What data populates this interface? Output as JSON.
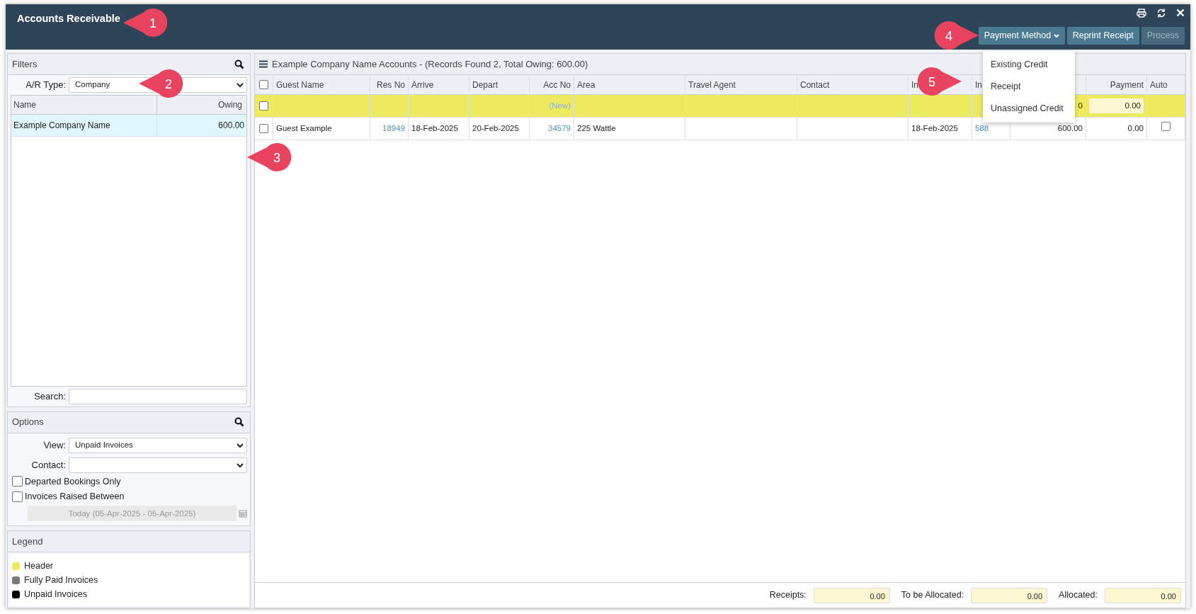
{
  "window": {
    "title": "Accounts Receivable"
  },
  "toolbar": {
    "buttons": [
      {
        "label": "Payment Method",
        "kind": "dropdown",
        "expanded": true,
        "disabled": false
      },
      {
        "label": "Reprint Receipt",
        "kind": "plain",
        "disabled": false
      },
      {
        "label": "Process",
        "kind": "plain",
        "disabled": true
      }
    ],
    "menu": [
      "Existing Credit",
      "Receipt",
      "Unassigned Credit"
    ]
  },
  "filters": {
    "title": "Filters",
    "ar_type_label": "A/R Type:",
    "ar_type_value": "Company",
    "columns": [
      "Name",
      "Owing"
    ],
    "rows": [
      {
        "name": "Example Company Name",
        "owing": "600.00",
        "selected": true
      }
    ],
    "search_label": "Search:"
  },
  "options": {
    "title": "Options",
    "view_label": "View:",
    "view_value": "Unpaid Invoices",
    "contact_label": "Contact:",
    "checkboxes": [
      {
        "label": "Departed Bookings Only",
        "checked": false
      },
      {
        "label": "Invoices Raised Between",
        "checked": false
      }
    ],
    "date_range": {
      "value": "Today (05-Apr-2025 - 05-Apr-2025)",
      "disabled": true
    }
  },
  "legend": {
    "title": "Legend",
    "items": [
      {
        "label": "Header",
        "color": "#eeea5e"
      },
      {
        "label": "Fully Paid Invoices",
        "color": "#7a7a7a"
      },
      {
        "label": "Unpaid Invoices",
        "color": "#000000"
      }
    ]
  },
  "accounts": {
    "title": "Example Company Name Accounts - (Records Found 2, Total Owing: 600.00)",
    "select_all": {
      "checked": false
    },
    "columns": [
      {
        "kind": "check"
      },
      {
        "label": "Guest Name",
        "kind": "text"
      },
      {
        "label": "Res No",
        "kind": "link"
      },
      {
        "label": "Arrive",
        "kind": "text"
      },
      {
        "label": "Depart",
        "kind": "text"
      },
      {
        "label": "Acc No",
        "kind": "link"
      },
      {
        "label": "Area",
        "kind": "text"
      },
      {
        "label": "Travel Agent",
        "kind": "text"
      },
      {
        "label": "Contact",
        "kind": "text"
      },
      {
        "label": "In",
        "kind": "text"
      },
      {
        "label": "In",
        "kind": "link"
      },
      {
        "kind": "number"
      },
      {
        "label": "Payment",
        "kind": "payment"
      },
      {
        "label": "Auto",
        "kind": "auto"
      }
    ],
    "rows": [
      {
        "kind": "header",
        "checked": false,
        "cells": {
          "5": "(New)",
          "11": "0",
          "12": "0.00"
        }
      },
      {
        "kind": "invoice",
        "checked": false,
        "auto": false,
        "cells": {
          "1": "Guest Example",
          "2": "18949",
          "3": "18-Feb-2025",
          "4": "20-Feb-2025",
          "5": "34579",
          "6": "225 Wattle",
          "9": "18-Feb-2025",
          "10": "588",
          "11": "600.00",
          "12": "0.00"
        }
      }
    ]
  },
  "totals": [
    {
      "label": "Receipts:",
      "value": "0.00"
    },
    {
      "label": "To be Allocated:",
      "value": "0.00"
    },
    {
      "label": "Allocated:",
      "value": "0.00"
    }
  ],
  "callouts": [
    "1",
    "2",
    "3",
    "4",
    "5"
  ]
}
